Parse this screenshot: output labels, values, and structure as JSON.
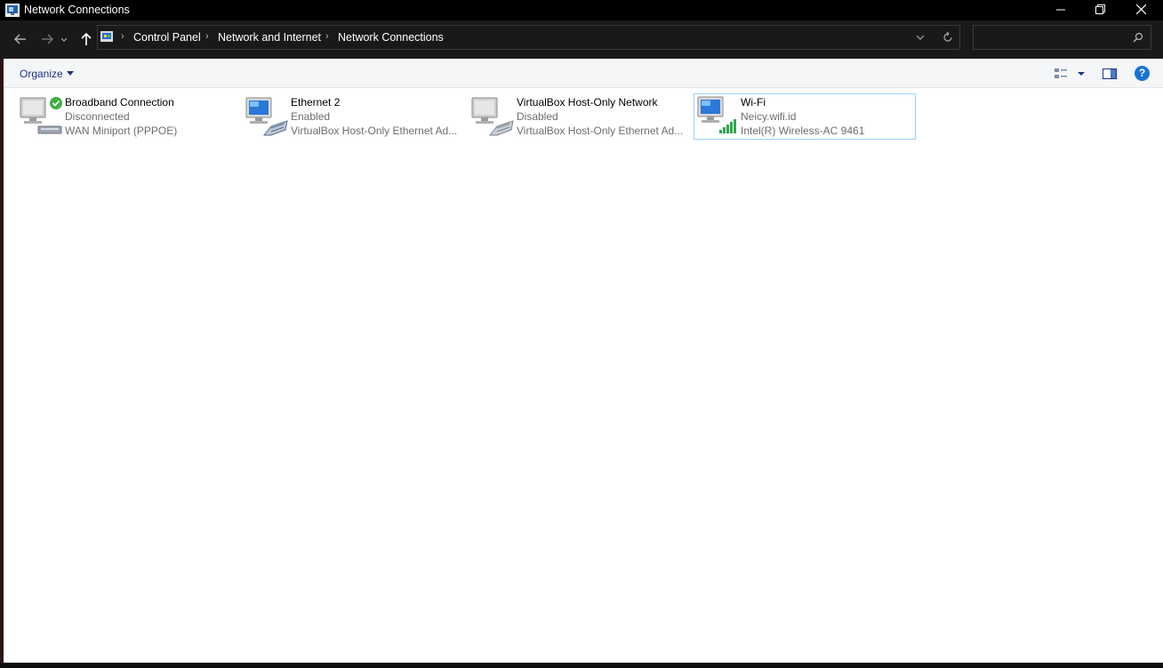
{
  "window": {
    "title": "Network Connections",
    "minimize_label": "─",
    "close_label": "✕"
  },
  "address": {
    "crumbs": [
      "Control Panel",
      "Network and Internet",
      "Network Connections"
    ],
    "separator": "›",
    "search_placeholder": ""
  },
  "toolbar": {
    "organize_label": "Organize",
    "help_label": "?"
  },
  "connections": [
    {
      "name": "Broadband Connection",
      "status": "Disconnected",
      "device": "WAN Miniport (PPPOE)",
      "icon": "broadband-connection-icon",
      "selected": false
    },
    {
      "name": "Ethernet 2",
      "status": "Enabled",
      "device": "VirtualBox Host-Only Ethernet Ad...",
      "icon": "ethernet-connection-icon",
      "selected": false
    },
    {
      "name": "VirtualBox Host-Only Network",
      "status": "Disabled",
      "device": "VirtualBox Host-Only Ethernet Ad...",
      "icon": "ethernet-disabled-icon",
      "selected": false
    },
    {
      "name": "Wi-Fi",
      "status": "Neicy.wifi.id",
      "device": "Intel(R) Wireless-AC 9461",
      "icon": "wifi-connection-icon",
      "selected": true
    }
  ],
  "colors": {
    "titlebar_bg": "#000000",
    "nav_bg": "#191919",
    "content_bg": "#ffffff",
    "selection_border": "#99d1ff",
    "link_blue": "#1e3287"
  }
}
